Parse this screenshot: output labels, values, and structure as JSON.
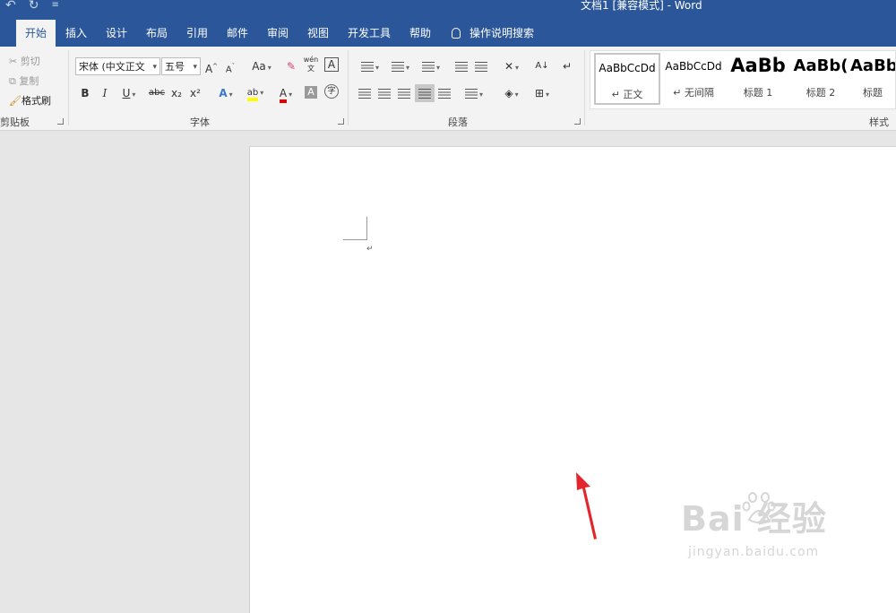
{
  "window": {
    "title": "文档1 [兼容模式]  -  Word",
    "qat": [
      "undo-icon",
      "redo-icon",
      "customize-qat-icon"
    ]
  },
  "tabs": [
    {
      "label": "开始",
      "active": true
    },
    {
      "label": "插入"
    },
    {
      "label": "设计"
    },
    {
      "label": "布局"
    },
    {
      "label": "引用"
    },
    {
      "label": "邮件"
    },
    {
      "label": "审阅"
    },
    {
      "label": "视图"
    },
    {
      "label": "开发工具"
    },
    {
      "label": "帮助"
    }
  ],
  "tell_me": "操作说明搜索",
  "clipboard": {
    "cut": "剪切",
    "copy": "复制",
    "format_painter": "格式刷",
    "group_label": "剪贴板"
  },
  "font": {
    "font_name": "宋体 (中文正文",
    "font_size": "五号",
    "grow": "A",
    "shrink": "A",
    "change_case": "Aa",
    "phonetic": "wén\n文",
    "char_border": "A",
    "bold": "B",
    "italic": "I",
    "underline": "U",
    "strike": "abc",
    "subscript": "x₂",
    "superscript": "x²",
    "text_effect": "A",
    "highlight": "ab",
    "font_color": "A",
    "char_shading": "A",
    "enclose": "字",
    "group_label": "字体"
  },
  "paragraph": {
    "group_label": "段落"
  },
  "styles": {
    "group_label": "样式",
    "items": [
      {
        "preview": "AaBbCcDd",
        "name": "↵ 正文"
      },
      {
        "preview": "AaBbCcDd",
        "name": "↵ 无间隔"
      },
      {
        "preview": "AaBb",
        "name": "标题 1"
      },
      {
        "preview": "AaBb(",
        "name": "标题 2"
      },
      {
        "preview": "AaBb",
        "name": "标题"
      }
    ]
  },
  "document": {
    "paragraph_mark": "↵"
  },
  "watermark": {
    "main": "Bai  经验",
    "sub": "jingyan.baidu.com"
  },
  "colors": {
    "brand": "#2b579a",
    "highlight_yellow": "#ffff00",
    "font_red": "#e00000",
    "arrow_red": "#e3262b"
  }
}
